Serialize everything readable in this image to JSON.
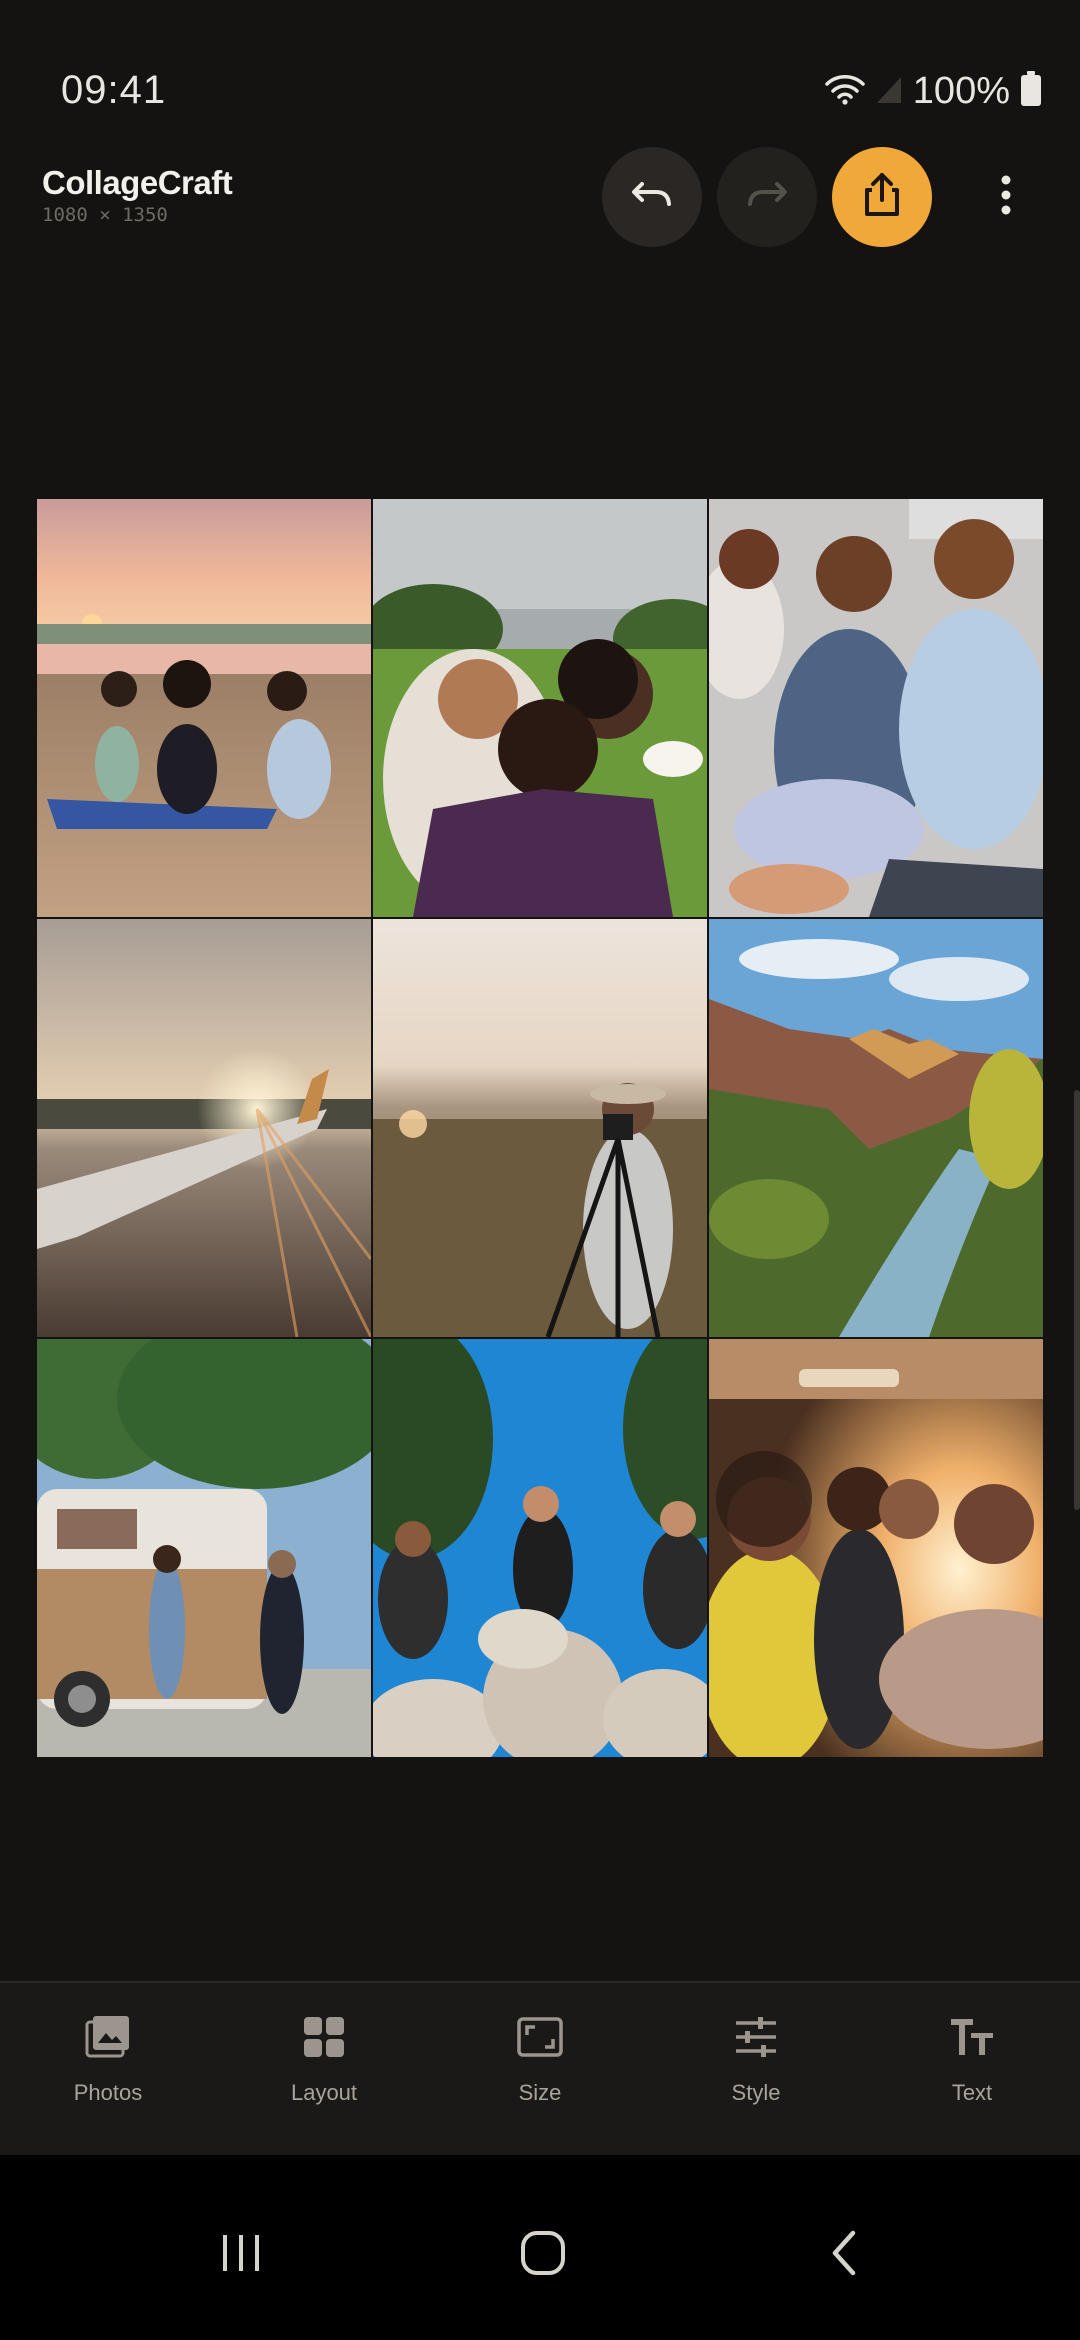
{
  "status": {
    "time": "09:41",
    "battery": "100%"
  },
  "header": {
    "title": "CollageCraft",
    "canvas_size": "1080 × 1350"
  },
  "colors": {
    "accent": "#f0a838",
    "background": "#151311",
    "toolbar": "#1b1917"
  },
  "collage": {
    "photos": [
      {
        "subject": "friends sitting on beach at sunset"
      },
      {
        "subject": "couple laughing in field"
      },
      {
        "subject": "three friends sitting outdoors"
      },
      {
        "subject": "airplane wing at sunset"
      },
      {
        "subject": "photographer with tripod in field"
      },
      {
        "subject": "canyon with river"
      },
      {
        "subject": "friends by camper van"
      },
      {
        "subject": "friends sitting on rocks"
      },
      {
        "subject": "friends taking selfie in car"
      }
    ]
  },
  "toolbar": {
    "items": [
      {
        "label": "Photos",
        "icon": "photos-icon"
      },
      {
        "label": "Layout",
        "icon": "layout-icon"
      },
      {
        "label": "Size",
        "icon": "size-icon"
      },
      {
        "label": "Style",
        "icon": "style-icon"
      },
      {
        "label": "Text",
        "icon": "text-icon"
      }
    ]
  }
}
